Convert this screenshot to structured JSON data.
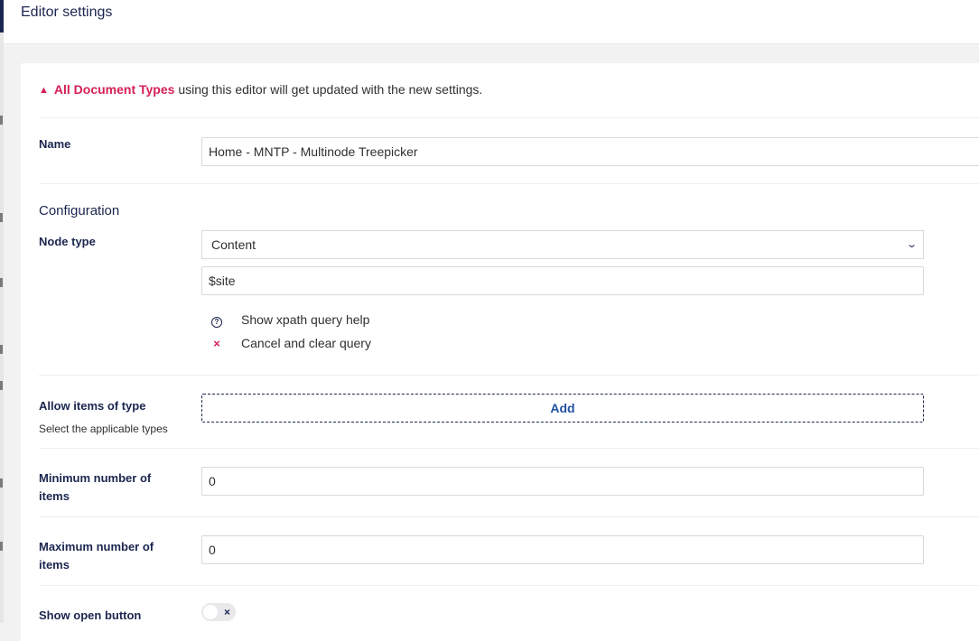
{
  "header": {
    "title": "Editor settings"
  },
  "warning": {
    "highlight": "All Document Types",
    "rest": " using this editor will get updated with the new settings."
  },
  "name": {
    "label": "Name",
    "value": "Home - MNTP - Multinode Treepicker"
  },
  "configuration": {
    "title": "Configuration"
  },
  "node_type": {
    "label": "Node type",
    "selected": "Content",
    "query_value": "$site",
    "help_label": "Show xpath query help",
    "cancel_label": "Cancel and clear query"
  },
  "allow_items": {
    "label": "Allow items of type",
    "description": "Select the applicable types",
    "add_label": "Add"
  },
  "min_items": {
    "label": "Minimum number of items",
    "value": "0"
  },
  "max_items": {
    "label": "Maximum number of items",
    "value": "0"
  },
  "show_open": {
    "label": "Show open button",
    "enabled": false
  },
  "colors": {
    "accent": "#d42054",
    "primary": "#1b264f",
    "link": "#2152a3"
  }
}
